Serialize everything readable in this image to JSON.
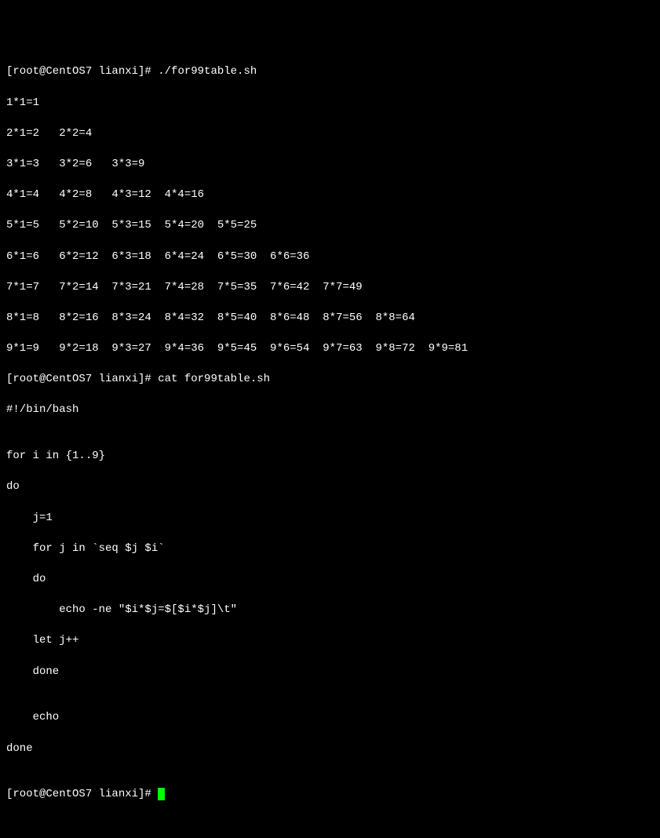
{
  "prompt1_user": "[root@CentOS7 lianxi]# ",
  "prompt1_cmd": "./for99table.sh",
  "table": {
    "r1": "1*1=1",
    "r2": "2*1=2   2*2=4",
    "r3": "3*1=3   3*2=6   3*3=9",
    "r4": "4*1=4   4*2=8   4*3=12  4*4=16",
    "r5": "5*1=5   5*2=10  5*3=15  5*4=20  5*5=25",
    "r6": "6*1=6   6*2=12  6*3=18  6*4=24  6*5=30  6*6=36",
    "r7": "7*1=7   7*2=14  7*3=21  7*4=28  7*5=35  7*6=42  7*7=49",
    "r8": "8*1=8   8*2=16  8*3=24  8*4=32  8*5=40  8*6=48  8*7=56  8*8=64",
    "r9": "9*1=9   9*2=18  9*3=27  9*4=36  9*5=45  9*6=54  9*7=63  9*8=72  9*9=81"
  },
  "prompt2_user": "[root@CentOS7 lianxi]# ",
  "prompt2_cmd": "cat for99table.sh",
  "script": {
    "l1": "#!/bin/bash",
    "l2": "",
    "l3": "for i in {1..9}",
    "l4": "do",
    "l5": "    j=1",
    "l6": "    for j in `seq $j $i`",
    "l7": "    do",
    "l8": "        echo -ne \"$i*$j=$[$i*$j]\\t\"",
    "l9": "    let j++",
    "l10": "    done",
    "l11": "",
    "l12": "    echo",
    "l13": "done",
    "l14": ""
  },
  "prompt3_user": "[root@CentOS7 lianxi]# "
}
